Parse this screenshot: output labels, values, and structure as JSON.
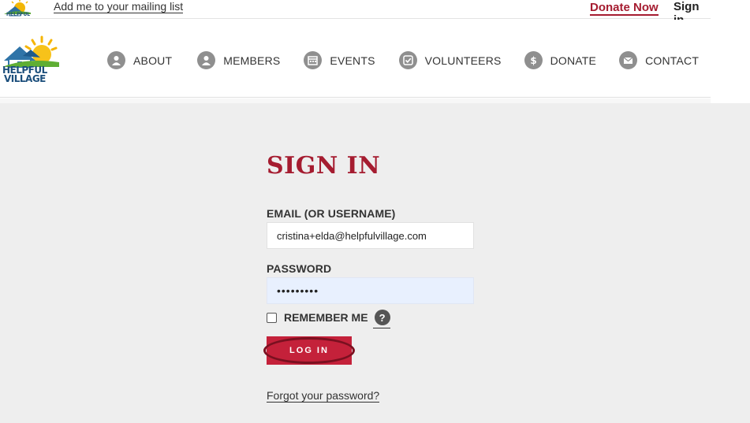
{
  "topbar": {
    "mini_logo_text": "HELPFUL",
    "mailing_list_link": "Add me to your mailing list",
    "donate_now_link": "Donate Now",
    "sign_in_link": "Sign in"
  },
  "logo": {
    "line1": "HELPFUL",
    "line2": "VILLAGE"
  },
  "nav": {
    "items": [
      {
        "label": "ABOUT",
        "icon": "person-icon"
      },
      {
        "label": "MEMBERS",
        "icon": "person-icon"
      },
      {
        "label": "EVENTS",
        "icon": "calendar-icon"
      },
      {
        "label": "VOLUNTEERS",
        "icon": "checkbox-icon"
      },
      {
        "label": "DONATE",
        "icon": "dollar-icon"
      },
      {
        "label": "CONTACT",
        "icon": "envelope-icon"
      }
    ]
  },
  "signin": {
    "title": "SIGN IN",
    "email_label": "EMAIL (OR USERNAME)",
    "email_value": "cristina+elda@helpfulvillage.com",
    "password_label": "PASSWORD",
    "password_value": "•••••••••",
    "remember_label": "REMEMBER ME",
    "help_glyph": "?",
    "login_button": "LOG IN",
    "forgot_link": "Forgot your password?"
  },
  "colors": {
    "brand_red": "#a51c30",
    "button_red": "#c4213a",
    "content_bg": "#eeeeee",
    "nav_icon_gray": "#8f8f8f"
  }
}
